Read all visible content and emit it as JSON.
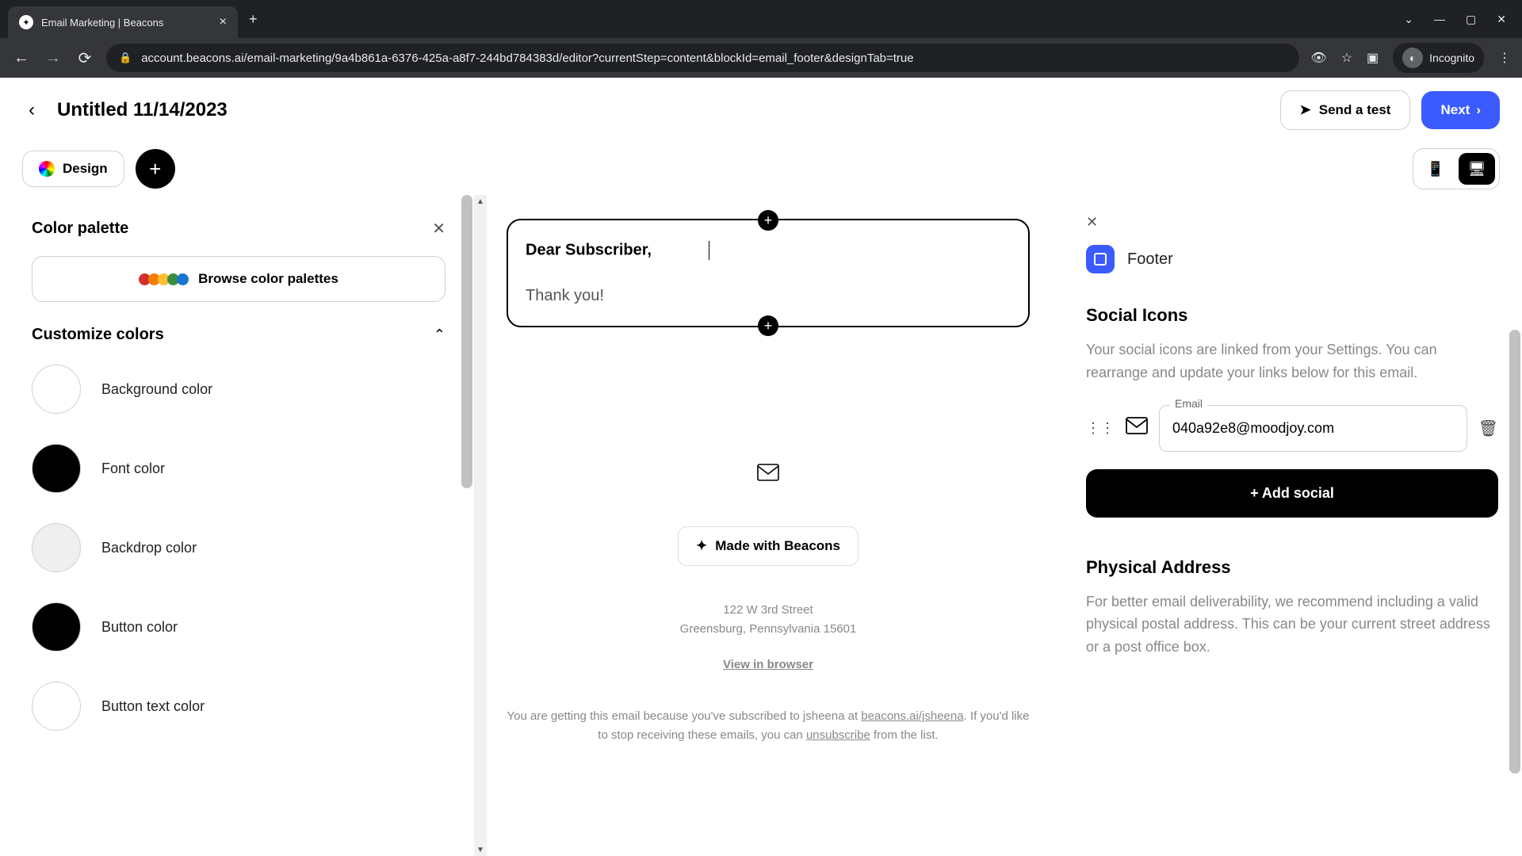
{
  "browser": {
    "tab_title": "Email Marketing | Beacons",
    "url": "account.beacons.ai/email-marketing/9a4b861a-6376-425a-a8f7-244bd784383d/editor?currentStep=content&blockId=email_footer&designTab=true",
    "incognito": "Incognito"
  },
  "header": {
    "title": "Untitled 11/14/2023",
    "send_test": "Send a test",
    "next": "Next"
  },
  "toolbar": {
    "design": "Design"
  },
  "left": {
    "color_palette": "Color palette",
    "browse": "Browse color palettes",
    "customize": "Customize colors",
    "colors": [
      {
        "label": "Background color",
        "hex": "#ffffff"
      },
      {
        "label": "Font color",
        "hex": "#000000"
      },
      {
        "label": "Backdrop color",
        "hex": "#efefef"
      },
      {
        "label": "Button color",
        "hex": "#000000"
      },
      {
        "label": "Button text color",
        "hex": "#ffffff"
      }
    ]
  },
  "email": {
    "greeting": "Dear Subscriber,",
    "body": "Thank you!",
    "made_with": "Made with Beacons",
    "addr1": "122 W 3rd Street",
    "addr2": "Greensburg, Pennsylvania 15601",
    "view_browser": "View in browser",
    "disclaimer_pre": "You are getting this email because you've subscribed to jsheena at ",
    "disclaimer_link1": "beacons.ai/jsheena",
    "disclaimer_mid": ". If you'd like to stop receiving these emails, you can ",
    "disclaimer_link2": "unsubscribe",
    "disclaimer_post": " from the list."
  },
  "right": {
    "footer": "Footer",
    "social_title": "Social Icons",
    "social_desc": "Your social icons are linked from your Settings. You can rearrange and update your links below for this email.",
    "email_label": "Email",
    "email_value": "040a92e8@moodjoy.com",
    "add_social": "+ Add social",
    "addr_title": "Physical Address",
    "addr_desc": "For better email deliverability, we recommend including a valid physical postal address. This can be your current street address or a post office box."
  }
}
